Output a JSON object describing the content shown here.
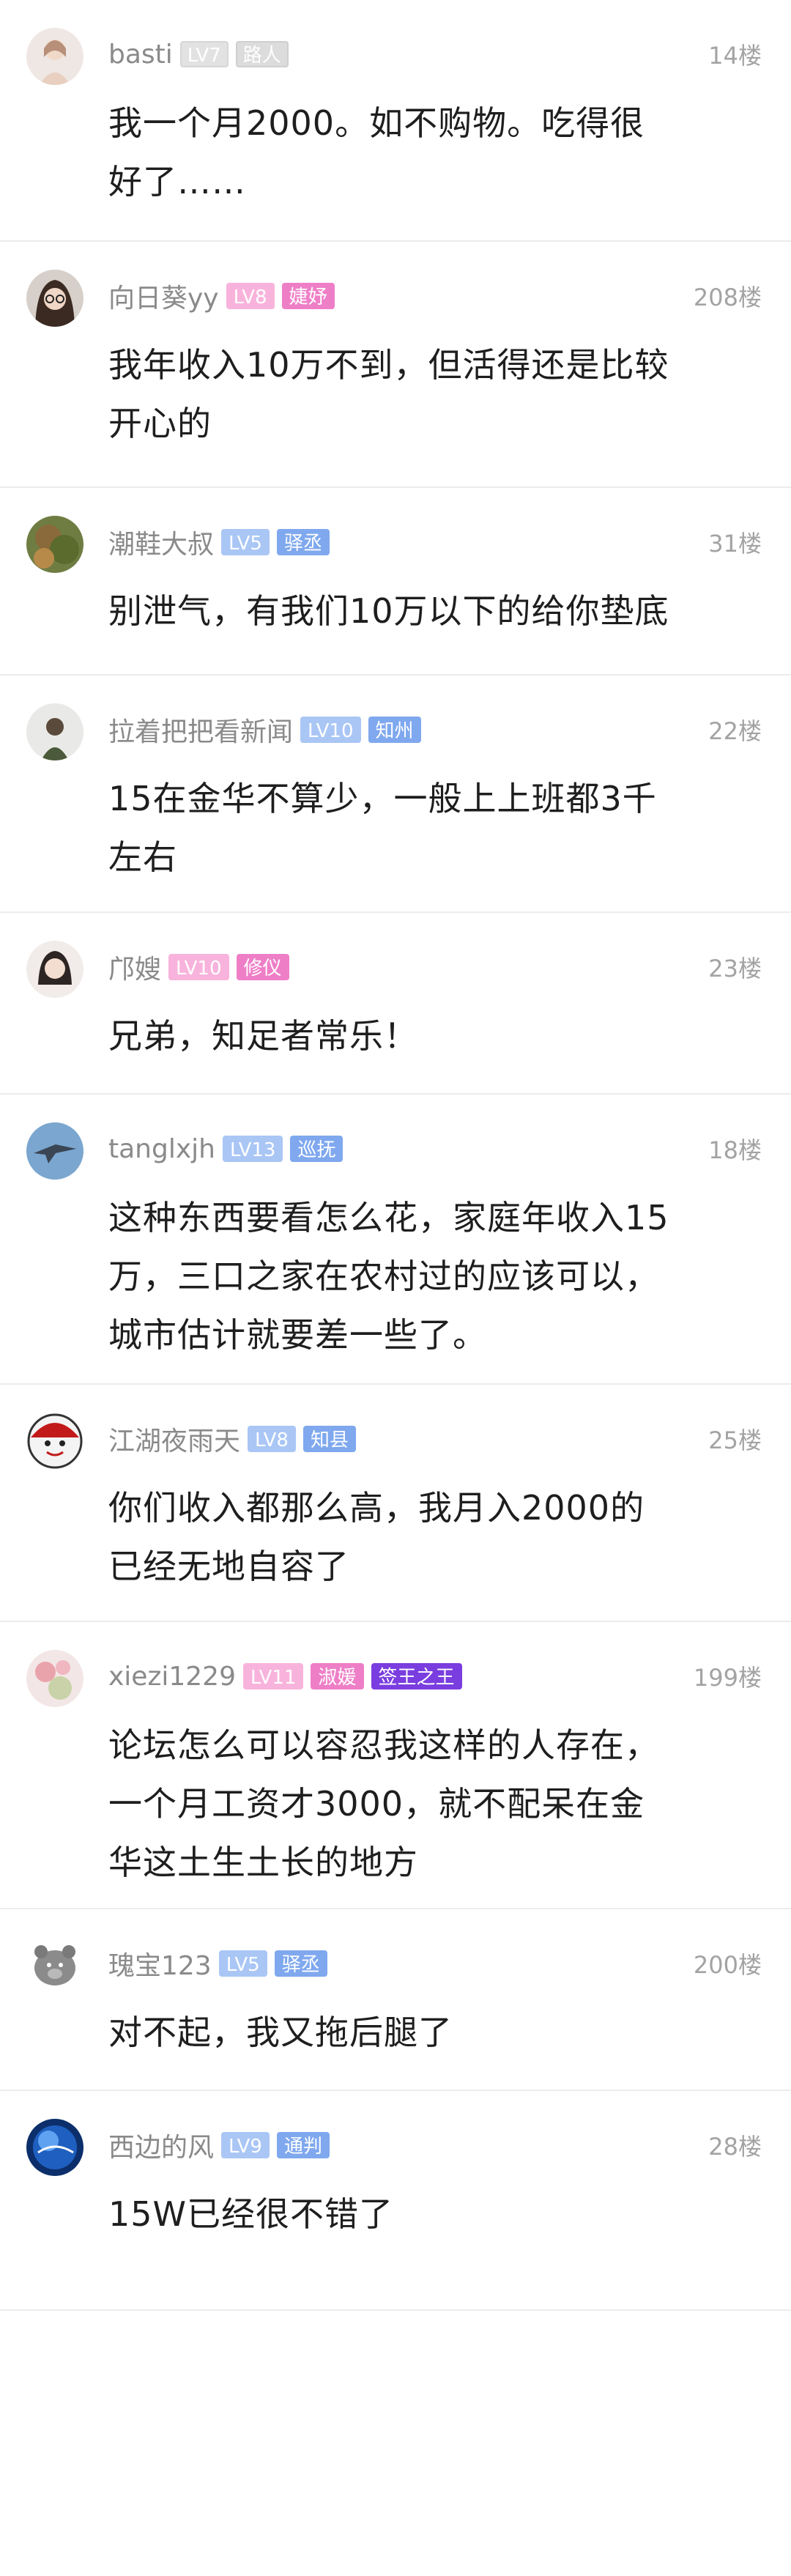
{
  "posts": [
    {
      "user": "basti",
      "level": "LV7",
      "title": "路人",
      "floor": "14楼",
      "lines": [
        "我一个月2000。如不购物。吃得很",
        "好了……"
      ],
      "level_style": "lv-gray",
      "title_style": "t-gray",
      "avatar": "girl-light"
    },
    {
      "user": "向日葵yy",
      "level": "LV8",
      "title": "婕妤",
      "floor": "208楼",
      "lines": [
        "我年收入10万不到，但活得还是比较",
        "开心的"
      ],
      "level_style": "lv-pink",
      "title_style": "t-pink",
      "avatar": "girl-glasses"
    },
    {
      "user": "潮鞋大叔",
      "level": "LV5",
      "title": "驿丞",
      "floor": "31楼",
      "lines": [
        "别泄气，有我们10万以下的给你垫底"
      ],
      "level_style": "lv-blue",
      "title_style": "t-blue",
      "avatar": "nature"
    },
    {
      "user": "拉着把把看新闻",
      "level": "LV10",
      "title": "知州",
      "floor": "22楼",
      "lines": [
        "15在金华不算少，一般上上班都3千",
        "左右"
      ],
      "level_style": "lv-blue",
      "title_style": "t-blue",
      "avatar": "man"
    },
    {
      "user": "邝嫂",
      "level": "LV10",
      "title": "修仪",
      "floor": "23楼",
      "lines": [
        "兄弟，知足者常乐！"
      ],
      "level_style": "lv-pink",
      "title_style": "t-pink",
      "avatar": "woman"
    },
    {
      "user": "tanglxjh",
      "level": "LV13",
      "title": "巡抚",
      "floor": "18楼",
      "lines": [
        "这种东西要看怎么花，家庭年收入15",
        "万，三口之家在农村过的应该可以，",
        "城市估计就要差一些了。"
      ],
      "level_style": "lv-blue",
      "title_style": "t-blue",
      "avatar": "jet"
    },
    {
      "user": "江湖夜雨天",
      "level": "LV8",
      "title": "知县",
      "floor": "25楼",
      "lines": [
        "你们收入都那么高，我月入2000的",
        "已经无地自容了"
      ],
      "level_style": "lv-blue",
      "title_style": "t-blue",
      "avatar": "face"
    },
    {
      "user": "xiezi1229",
      "level": "LV11",
      "title": "淑媛",
      "title2": "签王之王",
      "floor": "199楼",
      "lines": [
        "论坛怎么可以容忍我这样的人存在，",
        "一个月工资才3000，就不配呆在金",
        "华这土生土长的地方"
      ],
      "level_style": "lv-pink",
      "title_style": "t-pink",
      "title2_style": "t-purple",
      "avatar": "flowers"
    },
    {
      "user": "瑰宝123",
      "level": "LV5",
      "title": "驿丞",
      "floor": "200楼",
      "lines": [
        "对不起，我又拖后腿了"
      ],
      "level_style": "lv-blue",
      "title_style": "t-blue",
      "avatar": "pig"
    },
    {
      "user": "西边的风",
      "level": "LV9",
      "title": "通判",
      "floor": "28楼",
      "lines": [
        "15W已经很不错了"
      ],
      "level_style": "lv-blue",
      "title_style": "t-blue",
      "avatar": "sphere"
    }
  ],
  "colors": {
    "name": "#8a8a8a",
    "floor": "#a3a3a3",
    "content": "#1e1e1e",
    "divider": "#ececec",
    "lv_gray_bg": "#d9d9d9",
    "lv_pink_bg": "#f7a8d8",
    "lv_blue_bg": "#a7c4f4",
    "title_purple_bg": "#7b3fe0"
  }
}
